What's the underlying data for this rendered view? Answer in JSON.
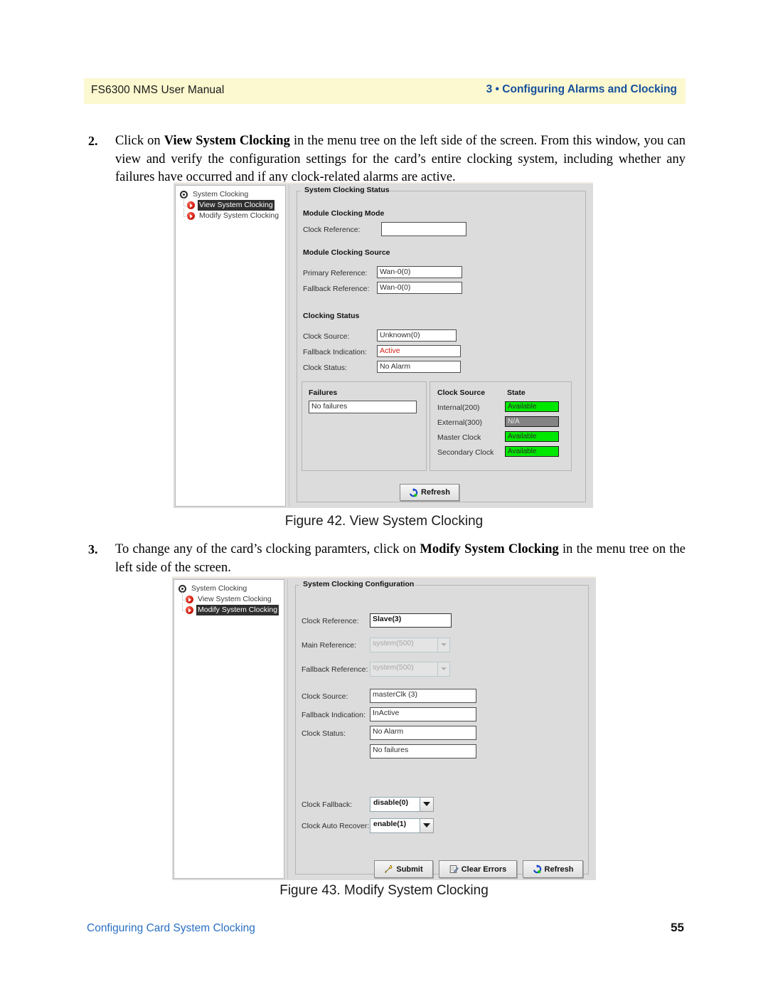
{
  "header": {
    "left_title": "FS6300 NMS User Manual",
    "right_title": "3 • Configuring Alarms and Clocking",
    "band_color": "#fcf8cf",
    "right_color": "#15509e"
  },
  "steps": {
    "step2": {
      "number": "2.",
      "text_part1": "Click on ",
      "bold1": "View System Clocking",
      "text_part2": " in the menu tree on the left side of the screen. From this window, you can view and verify the configuration settings for the card’s entire clocking system, including whether any failures have occurred and if any clock-related alarms are active."
    },
    "step3": {
      "number": "3.",
      "text_part1": "To change any of the card’s clocking paramters, click on ",
      "bold1": "Modify System Clocking",
      "text_part2": " in the menu tree on the left side of the screen."
    }
  },
  "figure42": {
    "caption": "Figure 42. View System Clocking",
    "tree": {
      "root": "System Clocking",
      "children": [
        {
          "label": "View System Clocking",
          "selected": true
        },
        {
          "label": "Modify System Clocking",
          "selected": false
        }
      ]
    },
    "group_title": "System Clocking Status",
    "sections": {
      "mode_title": "Module Clocking Mode",
      "source_title": "Module Clocking Source",
      "status_title": "Clocking Status"
    },
    "fields": [
      {
        "label": "Clock Reference:",
        "value": ""
      },
      {
        "label": "Primary Reference:",
        "value": "Wan-0(0)"
      },
      {
        "label": "Fallback Reference:",
        "value": "Wan-0(0)"
      },
      {
        "label": "Clock Source:",
        "value": "Unknown(0)"
      },
      {
        "label": "Fallback Indication:",
        "value": "Active"
      },
      {
        "label": "Clock Status:",
        "value": "No Alarm"
      }
    ],
    "failures": {
      "title": "Failures",
      "value": "No failures"
    },
    "clock_table": {
      "col_source": "Clock Source",
      "col_state": "State",
      "rows": [
        {
          "source": "Internal(200)",
          "state": "Available",
          "state_kind": "available"
        },
        {
          "source": "External(300)",
          "state": "N/A",
          "state_kind": "na"
        },
        {
          "source": "Master Clock",
          "state": "Available",
          "state_kind": "available"
        },
        {
          "source": "Secondary Clock",
          "state": "Available",
          "state_kind": "available"
        }
      ]
    },
    "refresh_button": "Refresh"
  },
  "figure43": {
    "caption": "Figure 43. Modify System Clocking",
    "tree": {
      "root": "System Clocking",
      "children": [
        {
          "label": "View System Clocking",
          "selected": false
        },
        {
          "label": "Modify System Clocking",
          "selected": true
        }
      ]
    },
    "group_title": "System Clocking Configuration",
    "fields": [
      {
        "label": "Clock Reference:",
        "value": "Slave(3)"
      },
      {
        "label": "Main Reference:",
        "value": "system(500)"
      },
      {
        "label": "Fallback Reference:",
        "value": "system(500)"
      },
      {
        "label": "Clock Source:",
        "value": "masterClk (3)"
      },
      {
        "label": "Fallback Indication:",
        "value": "InActive"
      },
      {
        "label": "Clock Status:",
        "value": "No Alarm"
      },
      {
        "label": "",
        "value": "No failures"
      },
      {
        "label": "Clock Fallback:",
        "value": "disable(0)"
      },
      {
        "label": "Clock Auto Recover:",
        "value": "enable(1)"
      }
    ],
    "buttons": {
      "submit": "Submit",
      "clear_errors": "Clear Errors",
      "refresh": "Refresh"
    }
  },
  "footer": {
    "left": "Configuring Card System Clocking",
    "page_number": "55",
    "link_color": "#2a6fc4"
  }
}
